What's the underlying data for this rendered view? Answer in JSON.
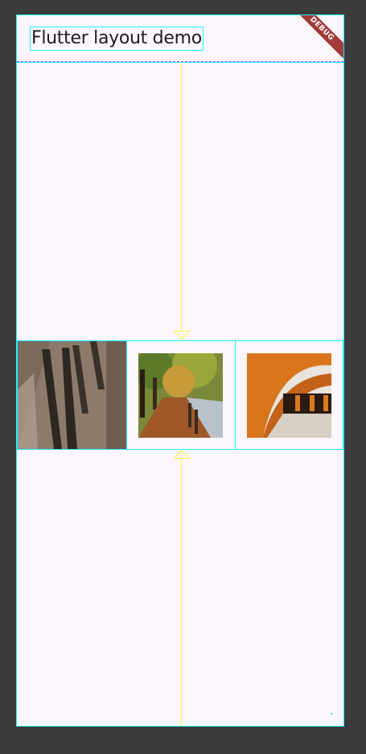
{
  "app": {
    "title": "Flutter layout demo",
    "debug_label": "DEBUG"
  },
  "images": [
    {
      "name": "shadows-on-sidewalk",
      "alt": ""
    },
    {
      "name": "autumn-path-by-water",
      "alt": ""
    },
    {
      "name": "orange-subway-tunnel",
      "alt": ""
    }
  ],
  "colors": {
    "background": "#fdf7fd",
    "outline": "#20f0ff",
    "guide": "#fff34a",
    "debug_banner": "#a13a3a",
    "frame": "#3b3b3b"
  }
}
